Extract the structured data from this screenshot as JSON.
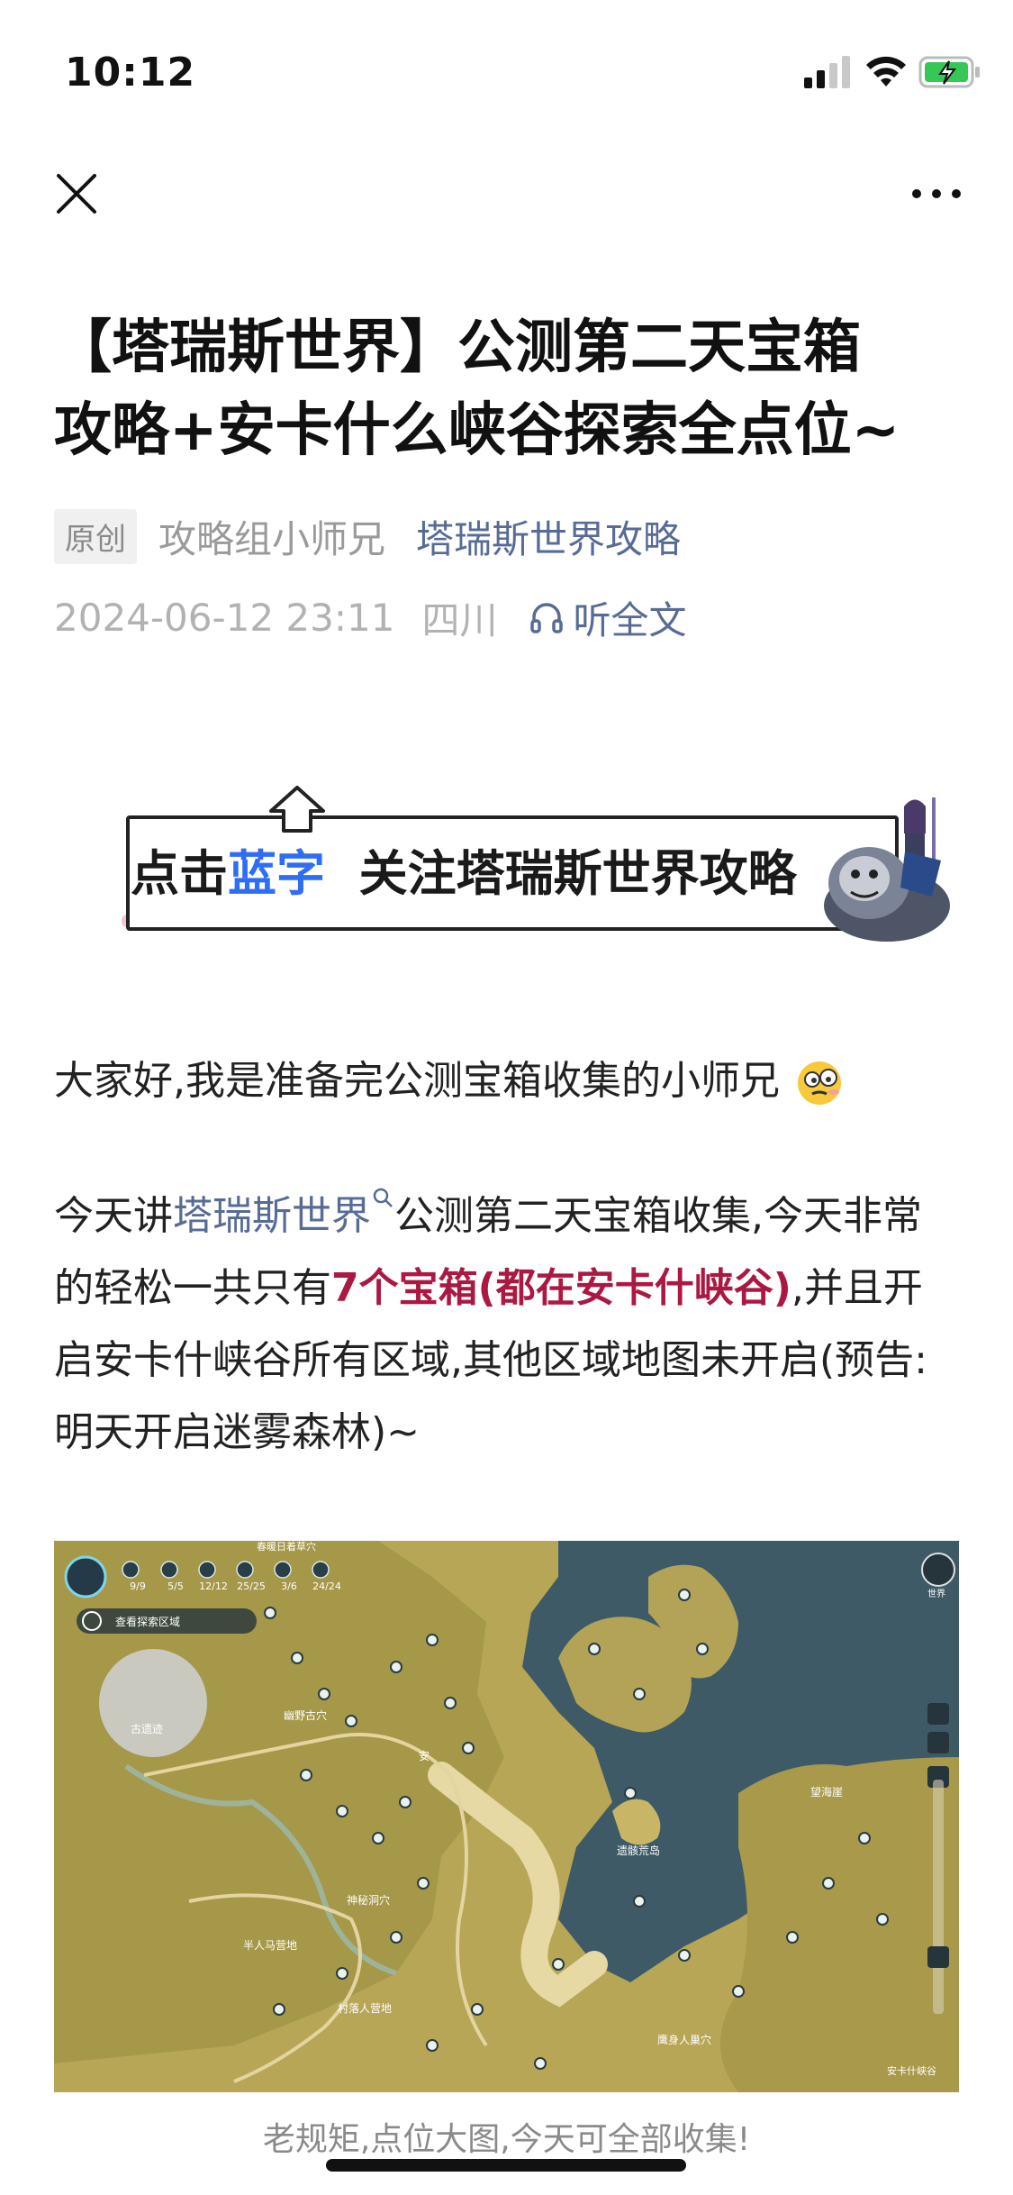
{
  "status_bar": {
    "time": "10:12"
  },
  "nav": {
    "close_icon": "close-icon",
    "more_icon": "more-icon"
  },
  "article": {
    "title_line1": "【塔瑞斯世界】公测第二天宝箱",
    "title_line2": "攻略+安卡什么峡谷探索全点位~",
    "badge": "原创",
    "author": "攻略组小师兄",
    "account": "塔瑞斯世界攻略",
    "date": "2024-06-12 23:11",
    "region": "四川",
    "listen_label": "听全文"
  },
  "banner": {
    "text_prefix": "点击",
    "text_blue": "蓝字",
    "text_suffix": "关注塔瑞斯世界攻略"
  },
  "body": {
    "p1": "大家好,我是准备完公测宝箱收集的小师兄",
    "p2_pre": "今天讲",
    "p2_link": "塔瑞斯世界",
    "p2_mid": "公测第二天宝箱收集,今天非常的轻松一共只有",
    "p2_highlight": "7个宝箱(都在安卡什峡谷)",
    "p2_post": ",并且开启安卡什峡谷所有区域,其他区域地图未开启(预告: 明天开启迷雾森林)~"
  },
  "map": {
    "counters": [
      "9/9",
      "5/5",
      "12/12",
      "25/25",
      "3/6",
      "24/24"
    ],
    "top_label": "春暖日着草穴",
    "explore_button": "查看探索区域",
    "labels": {
      "ruins": "古遗迹",
      "cave": "幽野古穴",
      "an": "安",
      "peak": "望海崖",
      "island": "遗骸荒岛",
      "camp": "半人马营地",
      "village": "村落人营地",
      "goblin": "神秘洞穴",
      "beast": "鹰身人巢穴",
      "region_name": "安卡什峡谷"
    },
    "world_label": "世界"
  },
  "caption": "老规矩,点位大图,今天可全部收集!"
}
